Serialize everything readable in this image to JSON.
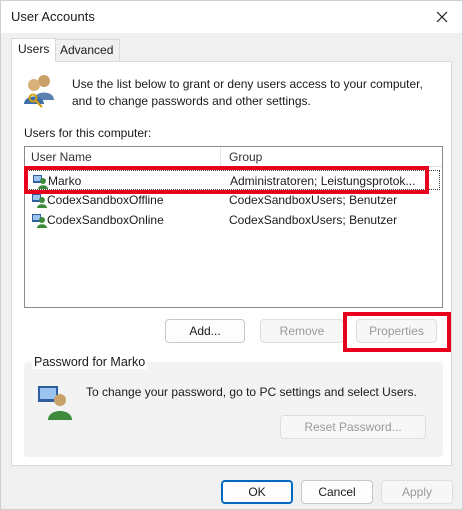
{
  "window": {
    "title": "User Accounts",
    "close_icon": "close-icon"
  },
  "tabs": [
    {
      "label": "Users",
      "active": true
    },
    {
      "label": "Advanced",
      "active": false
    }
  ],
  "intro": {
    "icon": "users-keys-icon",
    "text": "Use the list below to grant or deny users access to your computer, and to change passwords and other settings."
  },
  "users_list": {
    "label": "Users for this computer:",
    "columns": [
      "User Name",
      "Group"
    ],
    "rows": [
      {
        "name": "Marko",
        "group": "Administratoren; Leistungsprotok...",
        "selected": true,
        "icon": "user-account-icon"
      },
      {
        "name": "CodexSandboxOffline",
        "group": "CodexSandboxUsers; Benutzer",
        "selected": false,
        "icon": "user-account-icon"
      },
      {
        "name": "CodexSandboxOnline",
        "group": "CodexSandboxUsers; Benutzer",
        "selected": false,
        "icon": "user-account-icon"
      }
    ]
  },
  "list_buttons": {
    "add": "Add...",
    "remove": "Remove",
    "properties": "Properties"
  },
  "password_group": {
    "title": "Password for Marko",
    "icon": "user-password-icon",
    "text": "To change your password, go to PC settings and select Users.",
    "reset_button": "Reset Password..."
  },
  "footer": {
    "ok": "OK",
    "cancel": "Cancel",
    "apply": "Apply"
  },
  "colors": {
    "highlight": "#e8001c",
    "accent": "#0067c0"
  }
}
